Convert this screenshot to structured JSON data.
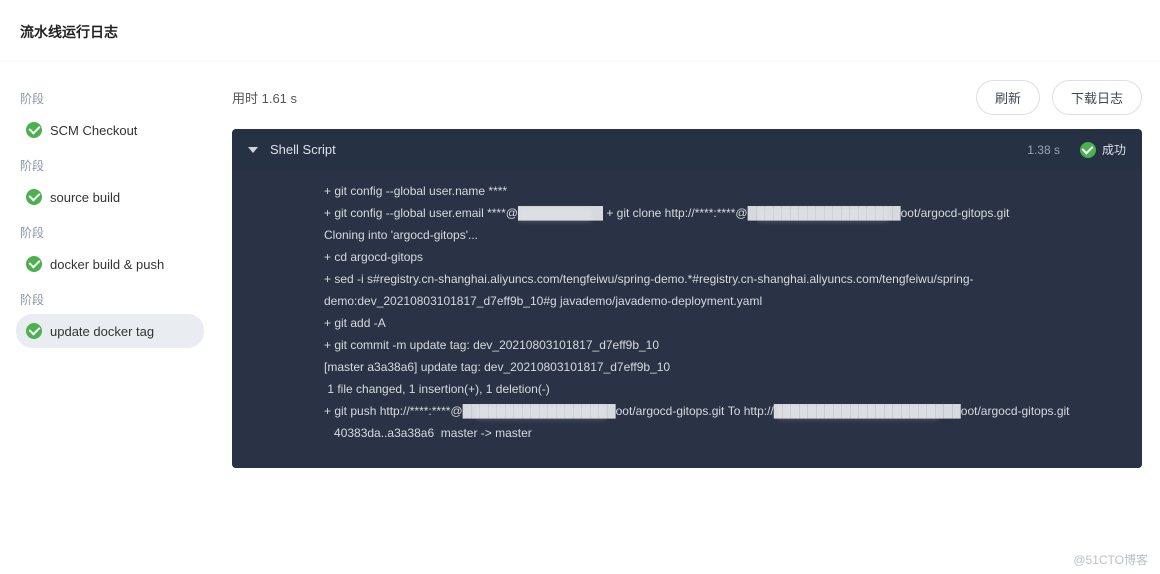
{
  "header": {
    "title": "流水线运行日志"
  },
  "sidebar": {
    "stage_label": "阶段",
    "stages": [
      {
        "name": "SCM Checkout"
      },
      {
        "name": "source build"
      },
      {
        "name": "docker build & push"
      },
      {
        "name": "update docker tag"
      }
    ]
  },
  "toolbar": {
    "duration_label": "用时 1.61 s",
    "refresh": "刷新",
    "download": "下载日志"
  },
  "log": {
    "step_title": "Shell Script",
    "duration": "1.38 s",
    "status_label": "成功",
    "lines": [
      "+ git config --global user.name ****",
      "+ git config --global user.email ****@██████████",
      "+ git clone http://****:****@██████████████████oot/argocd-gitops.git",
      "Cloning into 'argocd-gitops'...",
      "+ cd argocd-gitops",
      "+ sed -i s#registry.cn-shanghai.aliyuncs.com/tengfeiwu/spring-demo.*#registry.cn-shanghai.aliyuncs.com/tengfeiwu/spring-demo:dev_20210803101817_d7eff9b_10#g javademo/javademo-deployment.yaml",
      "+ git add -A",
      "+ git commit -m update tag: dev_20210803101817_d7eff9b_10",
      "[master a3a38a6] update tag: dev_20210803101817_d7eff9b_10",
      " 1 file changed, 1 insertion(+), 1 deletion(-)",
      "+ git push http://****:****@██████████████████oot/argocd-gitops.git",
      "To http://██████████████████████oot/argocd-gitops.git",
      "   40383da..a3a38a6  master -> master"
    ]
  },
  "watermark": "@51CTO博客"
}
